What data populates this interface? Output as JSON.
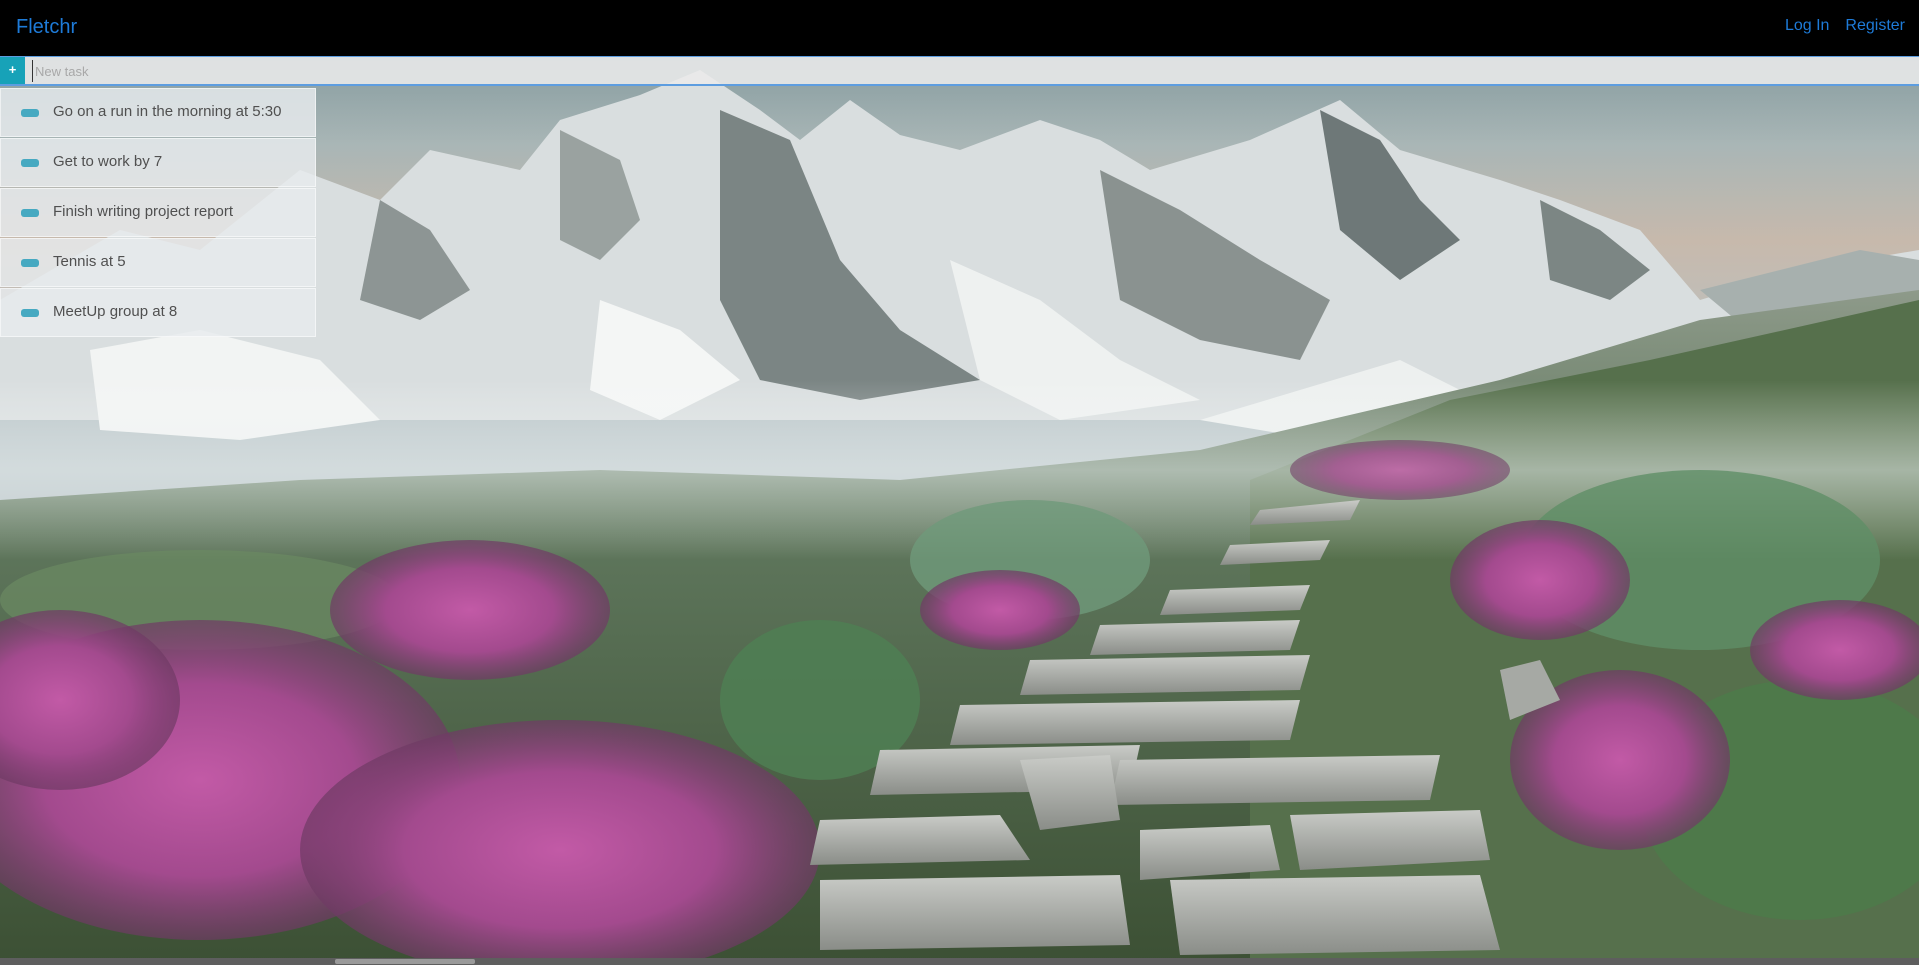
{
  "navbar": {
    "brand": "Fletchr",
    "login": "Log In",
    "register": "Register"
  },
  "new_task": {
    "button_label": "+",
    "placeholder": "New task",
    "value": ""
  },
  "tasks": [
    {
      "label": "Go on a run in the morning at 5:30"
    },
    {
      "label": "Get to work by 7"
    },
    {
      "label": "Finish writing project report"
    },
    {
      "label": "Tennis at 5"
    },
    {
      "label": "MeetUp group at 8"
    }
  ],
  "colors": {
    "navbar_bg": "#000000",
    "link": "#1e7bd8",
    "accent": "#17a2b8",
    "toggle": "#46a9c1"
  },
  "background": {
    "icon": "mountain-landscape-image"
  }
}
